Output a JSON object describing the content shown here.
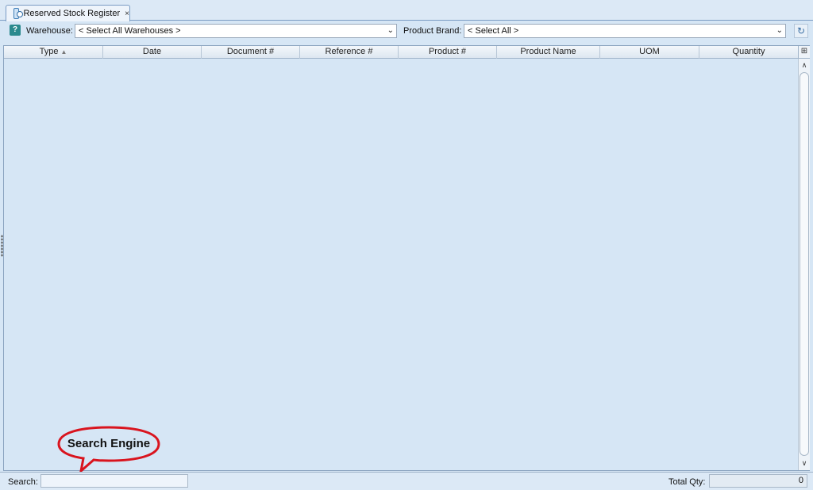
{
  "tab": {
    "title": "Reserved Stock Register",
    "close": "×"
  },
  "filters": {
    "warehouse_label": "Warehouse:",
    "warehouse_value": "< Select All Warehouses >",
    "brand_label": "Product Brand:",
    "brand_value": "< Select All >"
  },
  "grid": {
    "columns": [
      {
        "label": "Type",
        "sort": "▲"
      },
      {
        "label": "Date"
      },
      {
        "label": "Document #"
      },
      {
        "label": "Reference #"
      },
      {
        "label": "Product #"
      },
      {
        "label": "Product Name"
      },
      {
        "label": "UOM"
      },
      {
        "label": "Quantity"
      }
    ],
    "rows": []
  },
  "status": {
    "search_label": "Search:",
    "total_label": "Total Qty:",
    "total_value": "0"
  },
  "annotation": {
    "text": "Search Engine",
    "color": "#d9141e"
  },
  "icons": {
    "help": "?",
    "refresh": "refresh-icon"
  }
}
